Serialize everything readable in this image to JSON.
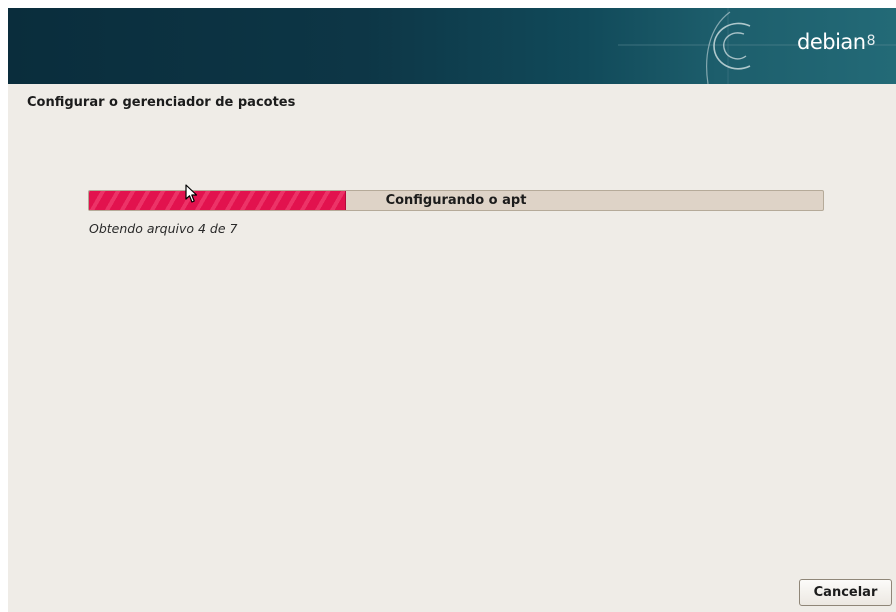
{
  "banner": {
    "logo_text": "debian",
    "logo_version": "8"
  },
  "page": {
    "title": "Configurar o gerenciador de pacotes"
  },
  "progress": {
    "label": "Configurando o apt",
    "status": "Obtendo arquivo 4 de 7",
    "fraction": 0.35
  },
  "buttons": {
    "cancel_label": "Cancelar"
  },
  "colors": {
    "accent": "#e2124e",
    "banner": "#0d3646",
    "window_bg": "#efece7"
  }
}
